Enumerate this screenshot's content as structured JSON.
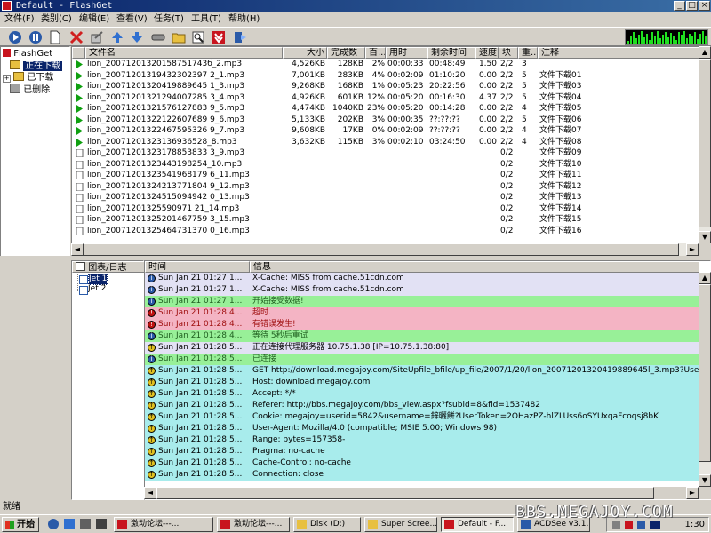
{
  "window": {
    "title": "Default - FlashGet"
  },
  "menu": [
    "文件(F)",
    "类别(C)",
    "编辑(E)",
    "查看(V)",
    "任务(T)",
    "工具(T)",
    "帮助(H)"
  ],
  "toolbar": [
    {
      "name": "start-icon",
      "color": "#2a5aa8"
    },
    {
      "name": "pause-icon",
      "color": "#2a5aa8"
    },
    {
      "name": "new-icon",
      "color": "#ffffff"
    },
    {
      "name": "delete-icon",
      "color": "#d02020"
    },
    {
      "name": "properties-icon",
      "color": "#808080"
    },
    {
      "name": "move-up-icon",
      "color": "#3070d0"
    },
    {
      "name": "move-down-icon",
      "color": "#3070d0"
    },
    {
      "name": "tools-icon",
      "color": "#808080"
    },
    {
      "name": "folder-icon",
      "color": "#e8c040"
    },
    {
      "name": "find-icon",
      "color": "#606060"
    },
    {
      "name": "flashget-icon",
      "color": "#c8141e"
    },
    {
      "name": "exit-icon",
      "color": "#2a5aa8"
    }
  ],
  "tree": {
    "root": "FlashGet",
    "items": [
      "正在下载",
      "已下载",
      "已删除"
    ]
  },
  "filelist": {
    "columns": [
      "文件名",
      "大小",
      "完成数",
      "百...",
      "用时",
      "剩余时间",
      "速度",
      "块",
      "重...",
      "注释"
    ],
    "rows": [
      {
        "state": "downloading",
        "name": "lion_20071201320158751743б_2.mp3",
        "size": "4,526KB",
        "done": "128KB",
        "pct": "2%",
        "time": "00:00:33",
        "left": "00:48:49",
        "speed": "1.50",
        "blocks": "2/2",
        "retry": "3",
        "note": ""
      },
      {
        "state": "downloading",
        "name": "lion_20071201319432302397 2_1.mp3",
        "size": "7,001KB",
        "done": "283KB",
        "pct": "4%",
        "time": "00:02:09",
        "left": "01:10:20",
        "speed": "0.00",
        "blocks": "2/2",
        "retry": "5",
        "note": "文件下载01"
      },
      {
        "state": "downloading",
        "name": "lion_20071201320419889645 1_3.mp3",
        "size": "9,268KB",
        "done": "168KB",
        "pct": "1%",
        "time": "00:05:23",
        "left": "20:22:56",
        "speed": "0.00",
        "blocks": "2/2",
        "retry": "5",
        "note": "文件下载03"
      },
      {
        "state": "downloading",
        "name": "lion_20071201321294007285 3_4.mp3",
        "size": "4,926KB",
        "done": "601KB",
        "pct": "12%",
        "time": "00:05:20",
        "left": "00:16:30",
        "speed": "4.37",
        "blocks": "2/2",
        "retry": "5",
        "note": "文件下载04"
      },
      {
        "state": "downloading",
        "name": "lion_20071201321576127883 9_5.mp3",
        "size": "4,474KB",
        "done": "1040KB",
        "pct": "23%",
        "time": "00:05:20",
        "left": "00:14:28",
        "speed": "0.00",
        "blocks": "2/2",
        "retry": "4",
        "note": "文件下载05"
      },
      {
        "state": "downloading",
        "name": "lion_20071201322122607689 9_6.mp3",
        "size": "5,133KB",
        "done": "202KB",
        "pct": "3%",
        "time": "00:00:35",
        "left": "??:??:??",
        "speed": "0.00",
        "blocks": "2/2",
        "retry": "5",
        "note": "文件下载06"
      },
      {
        "state": "downloading",
        "name": "lion_20071201322467595326 9_7.mp3",
        "size": "9,608KB",
        "done": "17KB",
        "pct": "0%",
        "time": "00:02:09",
        "left": "??:??:??",
        "speed": "0.00",
        "blocks": "2/2",
        "retry": "4",
        "note": "文件下载07"
      },
      {
        "state": "downloading",
        "name": "lion_20071201323136936528_8.mp3",
        "size": "3,632KB",
        "done": "115KB",
        "pct": "3%",
        "time": "00:02:10",
        "left": "03:24:50",
        "speed": "0.00",
        "blocks": "2/2",
        "retry": "4",
        "note": "文件下载08"
      },
      {
        "state": "waiting",
        "name": "lion_20071201323178853833 3_9.mp3",
        "size": "",
        "done": "",
        "pct": "",
        "time": "",
        "left": "",
        "speed": "",
        "blocks": "0/2",
        "retry": "",
        "note": "文件下载09"
      },
      {
        "state": "waiting",
        "name": "lion_20071201323443198254_10.mp3",
        "size": "",
        "done": "",
        "pct": "",
        "time": "",
        "left": "",
        "speed": "",
        "blocks": "0/2",
        "retry": "",
        "note": "文件下载10"
      },
      {
        "state": "waiting",
        "name": "lion_20071201323541968179 6_11.mp3",
        "size": "",
        "done": "",
        "pct": "",
        "time": "",
        "left": "",
        "speed": "",
        "blocks": "0/2",
        "retry": "",
        "note": "文件下载11"
      },
      {
        "state": "waiting",
        "name": "lion_20071201324213771804 9_12.mp3",
        "size": "",
        "done": "",
        "pct": "",
        "time": "",
        "left": "",
        "speed": "",
        "blocks": "0/2",
        "retry": "",
        "note": "文件下载12"
      },
      {
        "state": "waiting",
        "name": "lion_20071201324515094942 0_13.mp3",
        "size": "",
        "done": "",
        "pct": "",
        "time": "",
        "left": "",
        "speed": "",
        "blocks": "0/2",
        "retry": "",
        "note": "文件下载13"
      },
      {
        "state": "waiting",
        "name": "lion_20071201325590971 21_14.mp3",
        "size": "",
        "done": "",
        "pct": "",
        "time": "",
        "left": "",
        "speed": "",
        "blocks": "0/2",
        "retry": "",
        "note": "文件下载14"
      },
      {
        "state": "waiting",
        "name": "lion_20071201325201467759 3_15.mp3",
        "size": "",
        "done": "",
        "pct": "",
        "time": "",
        "left": "",
        "speed": "",
        "blocks": "0/2",
        "retry": "",
        "note": "文件下载15"
      },
      {
        "state": "waiting",
        "name": "lion_20071201325464731370 0_16.mp3",
        "size": "",
        "done": "",
        "pct": "",
        "time": "",
        "left": "",
        "speed": "",
        "blocks": "0/2",
        "retry": "",
        "note": "文件下载16"
      }
    ]
  },
  "jets": {
    "header": "图表/日志",
    "items": [
      "Jet 1",
      "Jet 2"
    ]
  },
  "log": {
    "columns": [
      "时间",
      "信息"
    ],
    "rows": [
      {
        "kind": "info",
        "bg": "#e2e1f4",
        "time": "Sun Jan 21 01:27:1...",
        "msg": "X-Cache: MISS from cache.51cdn.com"
      },
      {
        "kind": "info",
        "bg": "#e2e1f4",
        "time": "Sun Jan 21 01:27:1...",
        "msg": "X-Cache: MISS from cache.51cdn.com"
      },
      {
        "kind": "ok",
        "bg": "#98f098",
        "time": "Sun Jan 21 01:27:1...",
        "msg": "开始接受数据!"
      },
      {
        "kind": "error",
        "bg": "#f4b4c4",
        "time": "Sun Jan 21 01:28:4...",
        "msg": "超时."
      },
      {
        "kind": "error",
        "bg": "#f4b4c4",
        "time": "Sun Jan 21 01:28:4...",
        "msg": "有错误发生!"
      },
      {
        "kind": "ok",
        "bg": "#98f098",
        "time": "Sun Jan 21 01:28:4...",
        "msg": "等待 5秒后重试"
      },
      {
        "kind": "send",
        "bg": "#e2e1f4",
        "time": "Sun Jan 21 01:28:5...",
        "msg": "正在连接代理服务器 10.75.1.38 [IP=10.75.1.38:80]"
      },
      {
        "kind": "ok",
        "bg": "#98f098",
        "time": "Sun Jan 21 01:28:5...",
        "msg": "已连接"
      },
      {
        "kind": "send",
        "bg": "#a8ecec",
        "time": "Sun Jan 21 01:28:5...",
        "msg": "GET http://download.megajoy.com/SiteUpfile_bfile/up_file/2007/1/20/lion_20071201320419889645l_3.mp3?UserTok"
      },
      {
        "kind": "send",
        "bg": "#a8ecec",
        "time": "Sun Jan 21 01:28:5...",
        "msg": "Host: download.megajoy.com"
      },
      {
        "kind": "send",
        "bg": "#a8ecec",
        "time": "Sun Jan 21 01:28:5...",
        "msg": "Accept: */*"
      },
      {
        "kind": "send",
        "bg": "#a8ecec",
        "time": "Sun Jan 21 01:28:5...",
        "msg": "Referer: http://bbs.megajoy.com/bbs_view.aspx?fsubid=8&fid=1537482"
      },
      {
        "kind": "send",
        "bg": "#a8ecec",
        "time": "Sun Jan 21 01:28:5...",
        "msg": "Cookie: megajoy=userid=5842&username=鋅曬餅?UserToken=2OHazPZ-hlZLUss6oSYUxqaFcoqsj8bK"
      },
      {
        "kind": "send",
        "bg": "#a8ecec",
        "time": "Sun Jan 21 01:28:5...",
        "msg": "User-Agent: Mozilla/4.0 (compatible; MSIE 5.00; Windows 98)"
      },
      {
        "kind": "send",
        "bg": "#a8ecec",
        "time": "Sun Jan 21 01:28:5...",
        "msg": "Range: bytes=157358-"
      },
      {
        "kind": "send",
        "bg": "#a8ecec",
        "time": "Sun Jan 21 01:28:5...",
        "msg": "Pragma: no-cache"
      },
      {
        "kind": "send",
        "bg": "#a8ecec",
        "time": "Sun Jan 21 01:28:5...",
        "msg": "Cache-Control: no-cache"
      },
      {
        "kind": "send",
        "bg": "#a8ecec",
        "time": "Sun Jan 21 01:28:5...",
        "msg": "Connection: close"
      }
    ]
  },
  "statusbar": {
    "text": "就绪"
  },
  "taskbar": {
    "start": "开始",
    "tasks": [
      {
        "label": "激动论坛---...",
        "active": false,
        "icon": "#c8141e"
      },
      {
        "label": "激动论坛---...",
        "active": false,
        "icon": "#c8141e"
      },
      {
        "label": "Disk (D:)",
        "active": false,
        "icon": "#e8c040"
      },
      {
        "label": "Super Scree...",
        "active": false,
        "icon": "#e8c040"
      },
      {
        "label": "Default - F...",
        "active": true,
        "icon": "#c8141e"
      },
      {
        "label": "ACDSee v3.1...",
        "active": false,
        "icon": "#2a5aa8"
      }
    ],
    "clock": "1:30",
    "watermark": "BBS.MEGAJOY.COM"
  },
  "colors": {
    "selection": "#0a246a",
    "title_start": "#0a246a",
    "title_end": "#3a6ea5",
    "meter": "#20e020"
  },
  "meter_levels": [
    0.2,
    0.6,
    0.9,
    0.4,
    0.7,
    1.0,
    0.5,
    0.8,
    0.3,
    0.9,
    0.6,
    1.0,
    0.4,
    0.7,
    0.95,
    0.5,
    0.85,
    0.6,
    0.3,
    0.9,
    0.7,
    1.0,
    0.4,
    0.8,
    0.55,
    0.9,
    0.35,
    0.75,
    1.0,
    0.6
  ]
}
